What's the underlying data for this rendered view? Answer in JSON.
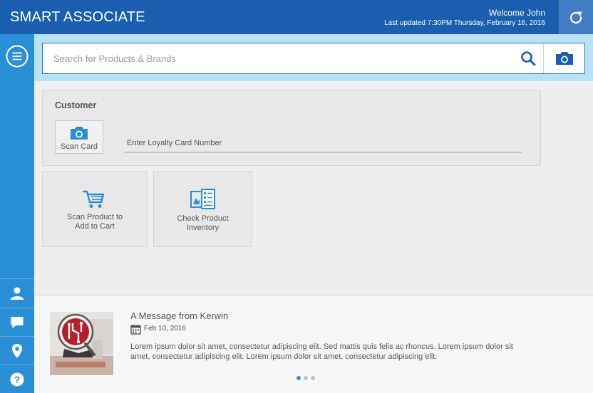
{
  "header": {
    "app_title": "SMART ASSOCIATE",
    "welcome": "Welcome John",
    "last_updated": "Last updated 7:30PM Thursday, February 16, 2016",
    "refresh_icon": "refresh-icon"
  },
  "sidebar": {
    "menu_icon": "menu-icon",
    "items": [
      {
        "icon": "user-icon"
      },
      {
        "icon": "chat-icon"
      },
      {
        "icon": "location-icon"
      },
      {
        "icon": "help-icon"
      }
    ]
  },
  "search": {
    "placeholder": "Search for Products & Brands",
    "value": "",
    "search_icon": "search-icon",
    "camera_icon": "camera-icon"
  },
  "customer": {
    "title": "Customer",
    "scan_card_label": "Scan Card",
    "loyalty_placeholder": "Enter Loyalty Card Number",
    "loyalty_value": ""
  },
  "tiles": [
    {
      "icon": "cart-icon",
      "label_line1": "Scan Product to",
      "label_line2": "Add to Cart"
    },
    {
      "icon": "inventory-icon",
      "label_line1": "Check Product",
      "label_line2": "Inventory"
    }
  ],
  "message": {
    "title": "A Message from Kerwin",
    "date": "Feb 10, 2016",
    "body": "Lorem ipsum dolor sit amet, consectetur adipiscing elit. Sed mattis quis felis ac rhoncus. Lorem ipsum dolor sit amet, consectetur adipiscing elit. Lorem ipsum dolor sit amet, consectetur adipiscing elit.",
    "pager": {
      "total": 3,
      "active": 1
    }
  },
  "colors": {
    "header": "#1a5fae",
    "sidebar": "#2a8fd6",
    "search_band": "#b8e2f4",
    "accent": "#2a8fd6"
  }
}
